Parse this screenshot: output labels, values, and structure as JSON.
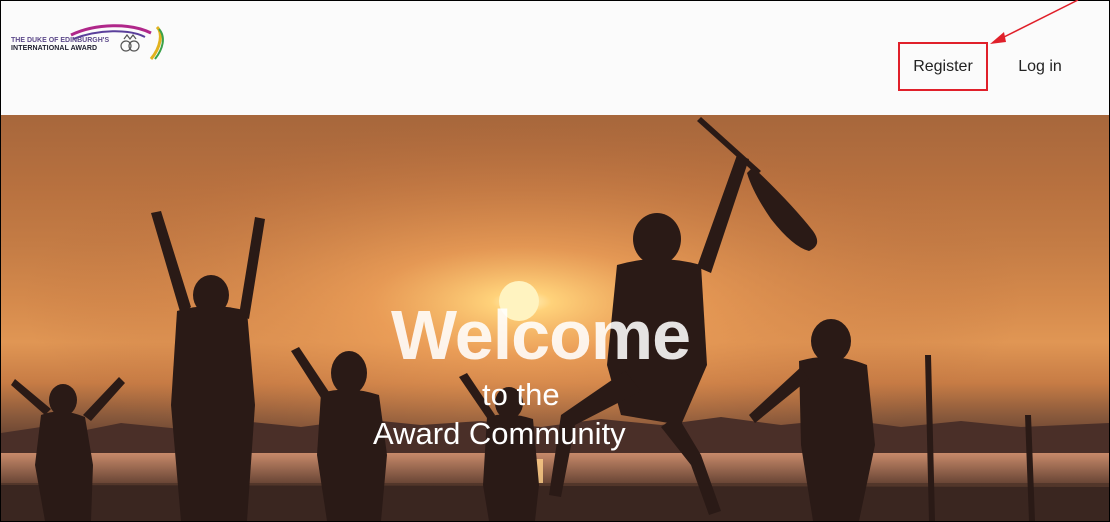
{
  "header": {
    "logo": {
      "line1": "THE DUKE OF EDINBURGH'S",
      "line2": "INTERNATIONAL AWARD",
      "icon": "award-swoosh-crown-logo"
    },
    "nav": {
      "register_label": "Register",
      "login_label": "Log in"
    }
  },
  "hero": {
    "title": "Welcome",
    "line2": "to the",
    "line3": "Award Community",
    "image": "silhouettes-jumping-at-sunset"
  },
  "annotation": {
    "highlight_color": "#e0202a",
    "target": "Register"
  },
  "colors": {
    "header_bg": "#fbfbfb",
    "text": "#222222",
    "hero_text": "#ffffff",
    "highlight": "#e0202a"
  }
}
